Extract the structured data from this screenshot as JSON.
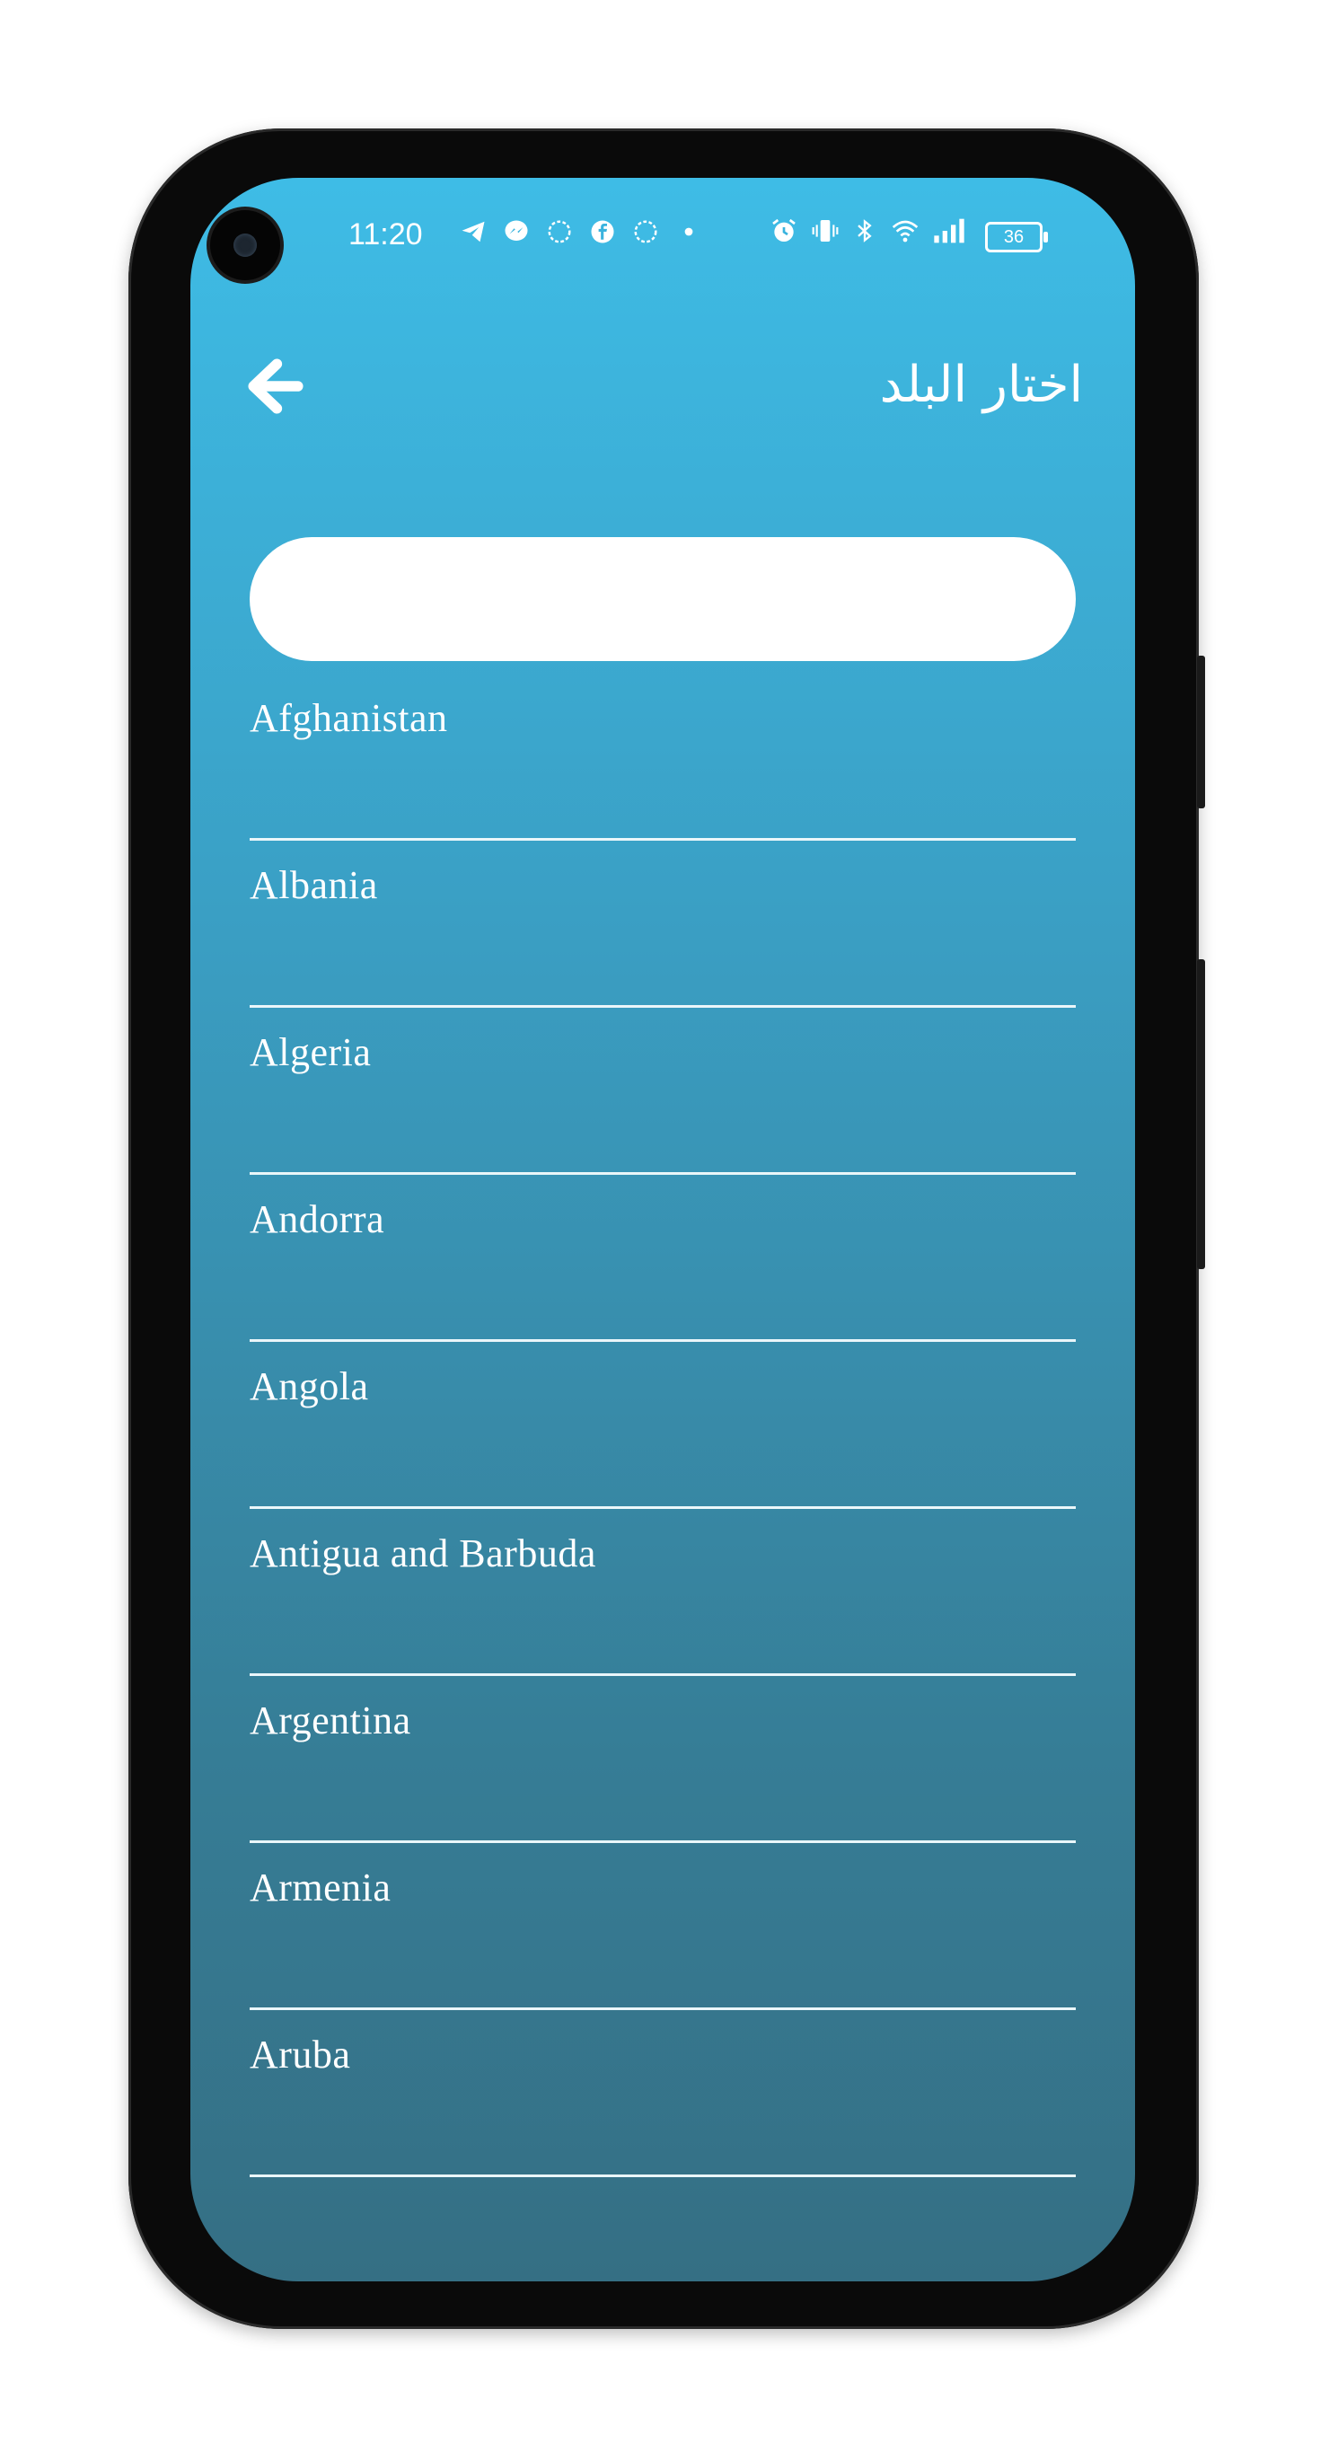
{
  "status_bar": {
    "time": "11:20",
    "notification_icons": [
      "telegram-icon",
      "messenger-icon",
      "brain-app-icon",
      "facebook-icon",
      "brain-app-icon",
      "dot-icon"
    ],
    "system_icons": [
      "alarm-icon",
      "vibrate-icon",
      "bluetooth-icon",
      "wifi-icon",
      "signal-icon"
    ],
    "battery": "36"
  },
  "header": {
    "title": "اختار البلد",
    "back_icon": "arrow-left-icon"
  },
  "search": {
    "value": "",
    "placeholder": ""
  },
  "countries": [
    "Afghanistan",
    "Albania",
    "Algeria",
    "Andorra",
    "Angola",
    "Antigua and Barbuda",
    "Argentina",
    "Armenia",
    "Aruba"
  ],
  "colors": {
    "gradient_top": "#3ebce6",
    "gradient_bottom": "#356f84",
    "text": "#ffffff",
    "divider": "#eaf6fa"
  }
}
